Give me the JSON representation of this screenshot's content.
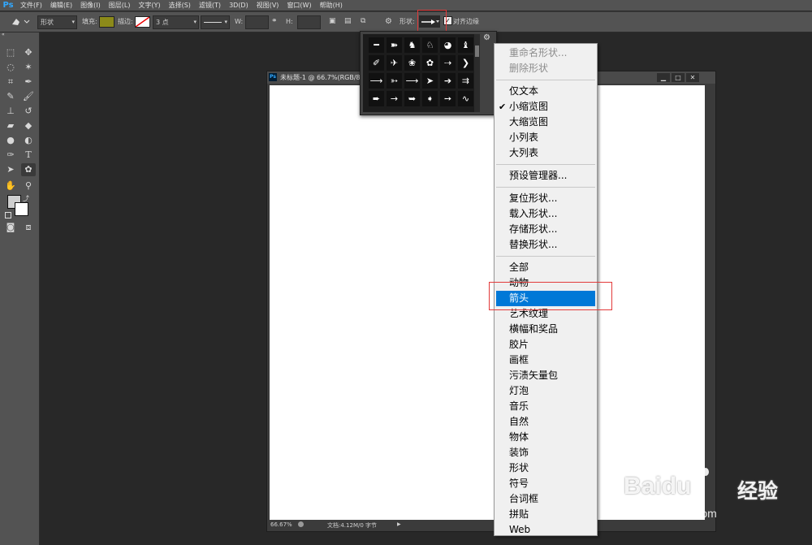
{
  "menubar": {
    "logo": "Ps",
    "items": [
      "文件(F)",
      "编辑(E)",
      "图像(I)",
      "图层(L)",
      "文字(Y)",
      "选择(S)",
      "滤镜(T)",
      "3D(D)",
      "视图(V)",
      "窗口(W)",
      "帮助(H)"
    ]
  },
  "options": {
    "mode": "形状",
    "fill_label": "填充:",
    "stroke_label": "描边:",
    "stroke_size": "3 点",
    "w_label": "W:",
    "h_label": "H:",
    "shape_label": "形状:",
    "align_label": "对齐边缘",
    "fill_color": "#8c8a1a"
  },
  "document": {
    "title": "未标题-1 @ 66.7%(RGB/8)",
    "zoom": "66.67%",
    "doc_info": "文档:4.12M/0 字节"
  },
  "context_menu": {
    "items": [
      {
        "label": "重命名形状...",
        "disabled": true
      },
      {
        "label": "删除形状",
        "disabled": true
      },
      {
        "label": "仅文本"
      },
      {
        "label": "小缩览图",
        "checked": true
      },
      {
        "label": "大缩览图"
      },
      {
        "label": "小列表"
      },
      {
        "label": "大列表"
      },
      {
        "label": "预设管理器..."
      },
      {
        "label": "复位形状..."
      },
      {
        "label": "载入形状..."
      },
      {
        "label": "存储形状..."
      },
      {
        "label": "替换形状..."
      },
      {
        "label": "全部"
      },
      {
        "label": "动物"
      },
      {
        "label": "箭头",
        "highlighted": true
      },
      {
        "label": "艺术纹理"
      },
      {
        "label": "横幅和奖品"
      },
      {
        "label": "胶片"
      },
      {
        "label": "画框"
      },
      {
        "label": "污渍矢量包"
      },
      {
        "label": "灯泡"
      },
      {
        "label": "音乐"
      },
      {
        "label": "自然"
      },
      {
        "label": "物体"
      },
      {
        "label": "装饰"
      },
      {
        "label": "形状"
      },
      {
        "label": "符号"
      },
      {
        "label": "台词框"
      },
      {
        "label": "拼贴"
      },
      {
        "label": "Web"
      }
    ]
  },
  "watermark": {
    "brand": "Bai",
    "brand2": "du",
    "suffix": "经验",
    "url": "jingyan.baidu.com"
  },
  "colors": {
    "highlight": "#0078d7",
    "red_marker": "#e23a3a",
    "ps_blue": "#31a8ff"
  }
}
